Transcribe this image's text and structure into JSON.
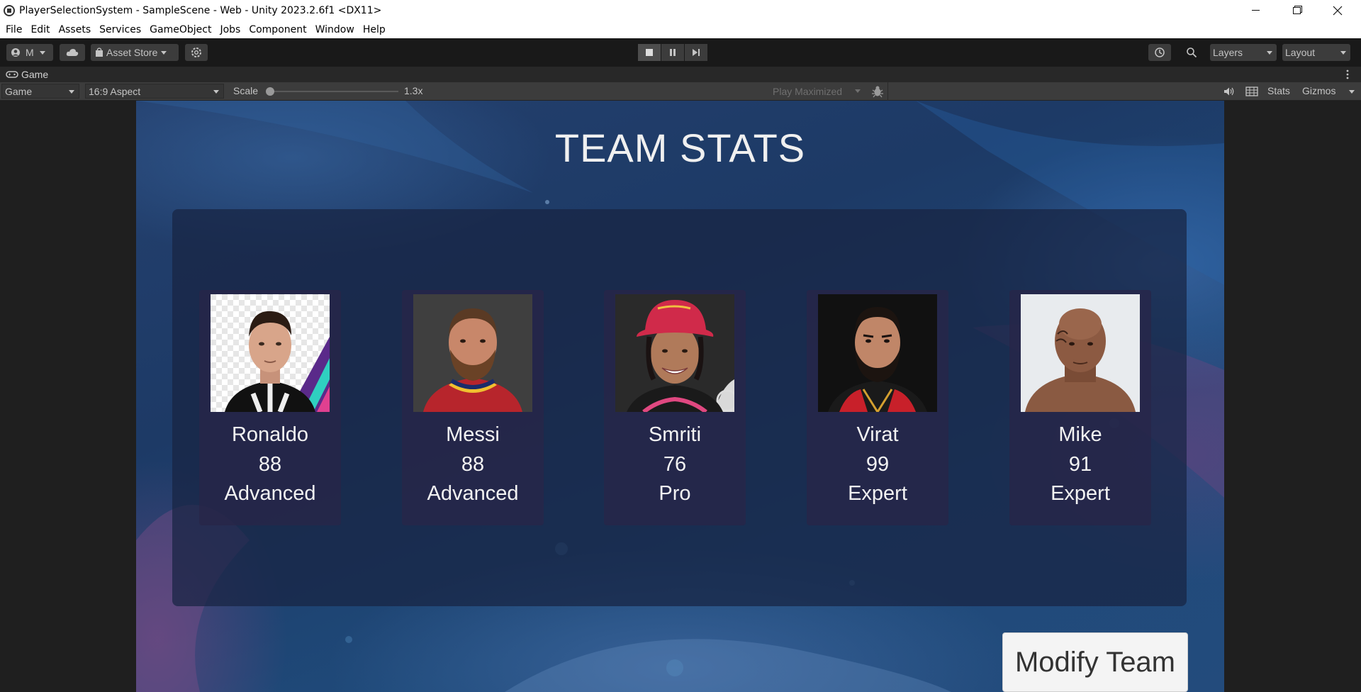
{
  "window": {
    "title": "PlayerSelectionSystem - SampleScene - Web - Unity 2023.2.6f1 <DX11>"
  },
  "menu": [
    "File",
    "Edit",
    "Assets",
    "Services",
    "GameObject",
    "Jobs",
    "Component",
    "Window",
    "Help"
  ],
  "toolbar": {
    "account_label": "M",
    "asset_store_label": "Asset Store",
    "layers_label": "Layers",
    "layout_label": "Layout"
  },
  "tab": {
    "label": "Game"
  },
  "game_toolbar": {
    "display": "Game",
    "aspect": "16:9 Aspect",
    "scale_label": "Scale",
    "scale_value": "1.3x",
    "play_mode": "Play Maximized",
    "stats_label": "Stats",
    "gizmos_label": "Gizmos"
  },
  "scene": {
    "title": "TEAM STATS",
    "players": [
      {
        "name": "Ronaldo",
        "rating": "88",
        "level": "Advanced"
      },
      {
        "name": "Messi",
        "rating": "88",
        "level": "Advanced"
      },
      {
        "name": "Smriti",
        "rating": "76",
        "level": "Pro"
      },
      {
        "name": "Virat",
        "rating": "99",
        "level": "Expert"
      },
      {
        "name": "Mike",
        "rating": "91",
        "level": "Expert"
      }
    ],
    "modify_button": "Modify Team"
  }
}
